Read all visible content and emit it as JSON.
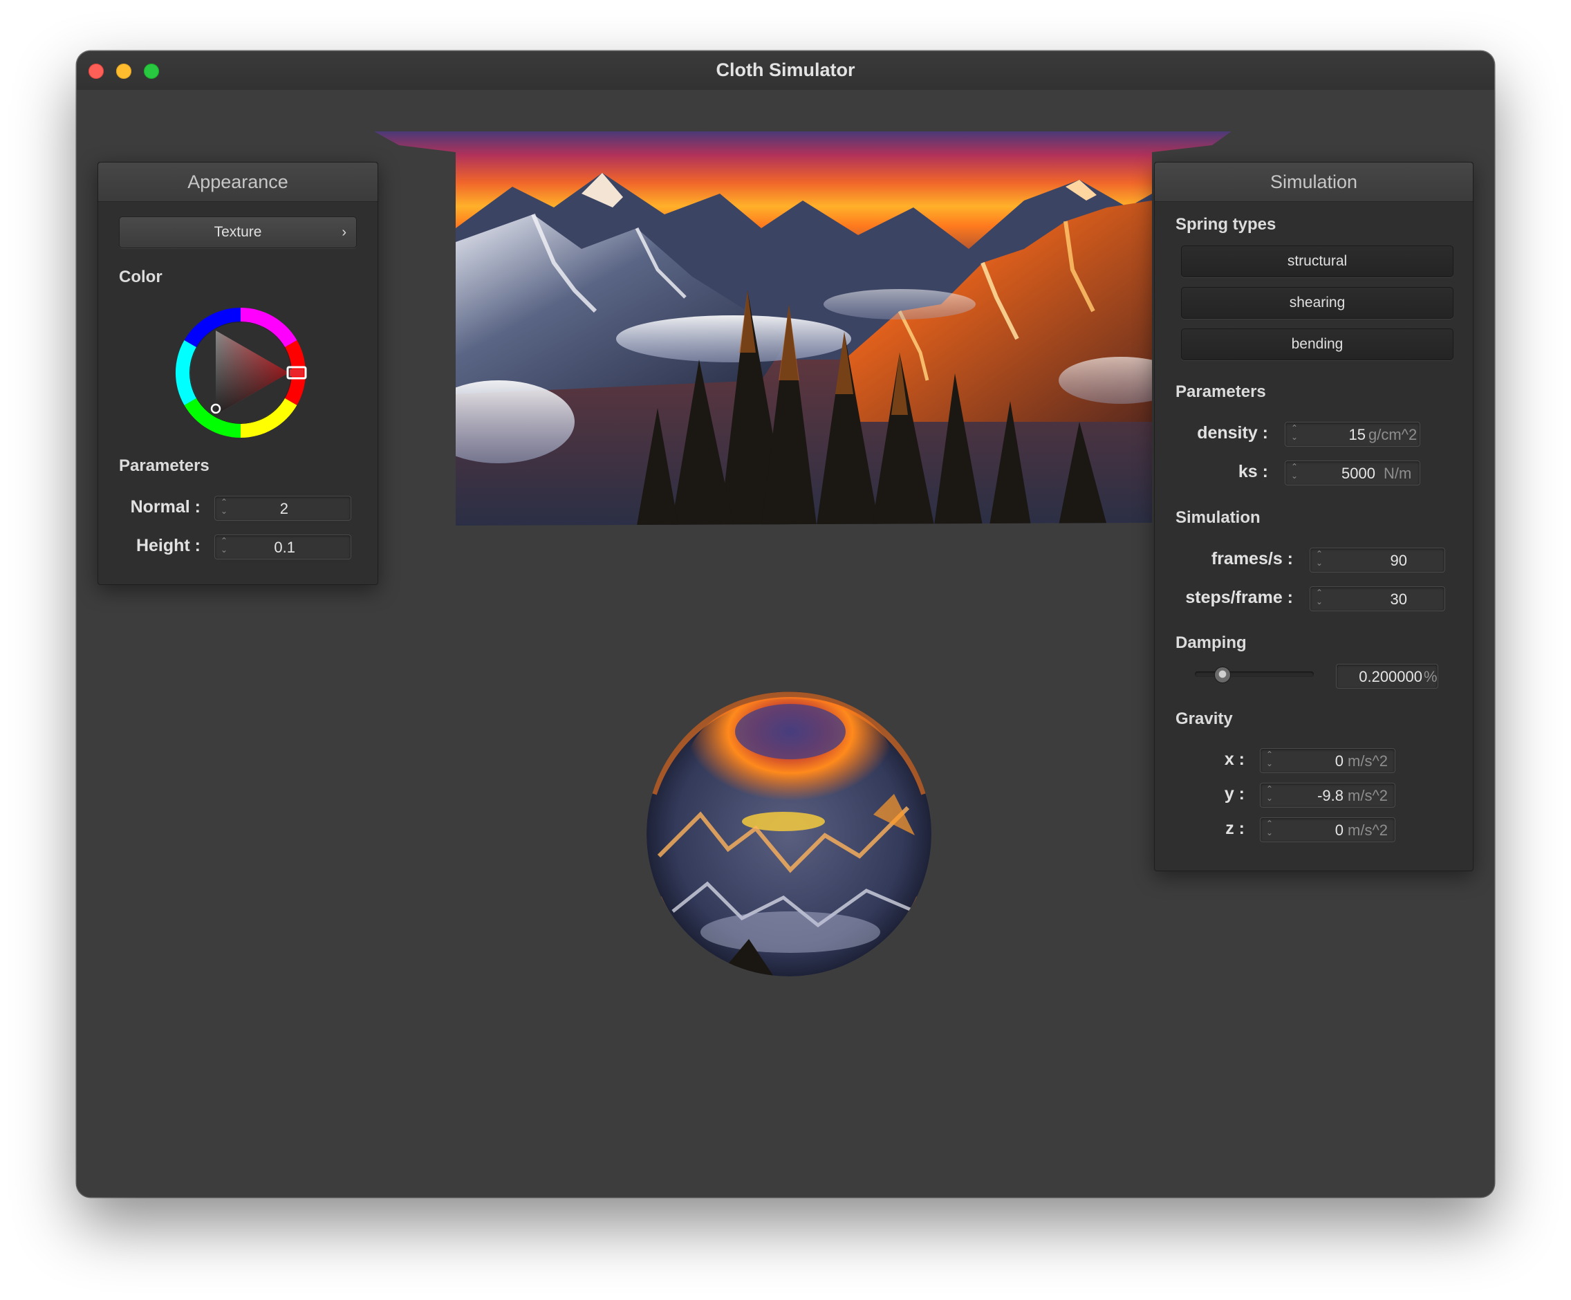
{
  "window": {
    "title": "Cloth Simulator"
  },
  "appearance": {
    "header": "Appearance",
    "texture_button": "Texture",
    "color_label": "Color",
    "parameters_label": "Parameters",
    "normal_label": "Normal :",
    "normal_value": "2",
    "height_label": "Height :",
    "height_value": "0.1"
  },
  "simulation": {
    "header": "Simulation",
    "spring_types_label": "Spring types",
    "spring_types": [
      "structural",
      "shearing",
      "bending"
    ],
    "parameters_label": "Parameters",
    "density_label": "density :",
    "density_value": "15",
    "density_unit": "g/cm^2",
    "ks_label": "ks :",
    "ks_value": "5000",
    "ks_unit": "N/m",
    "simulation_label": "Simulation",
    "fps_label": "frames/s :",
    "fps_value": "90",
    "steps_label": "steps/frame :",
    "steps_value": "30",
    "damping_label": "Damping",
    "damping_value": "0.200000",
    "damping_unit": "%",
    "damping_fraction": 0.2,
    "gravity_label": "Gravity",
    "gx_label": "x :",
    "gx_value": "0",
    "gy_label": "y :",
    "gy_value": "-9.8",
    "gz_label": "z :",
    "gz_value": "0",
    "gravity_unit": "m/s^2"
  },
  "colors": {
    "selected_color": "#e8262c",
    "viewport_bg": "#3d3d3d"
  }
}
